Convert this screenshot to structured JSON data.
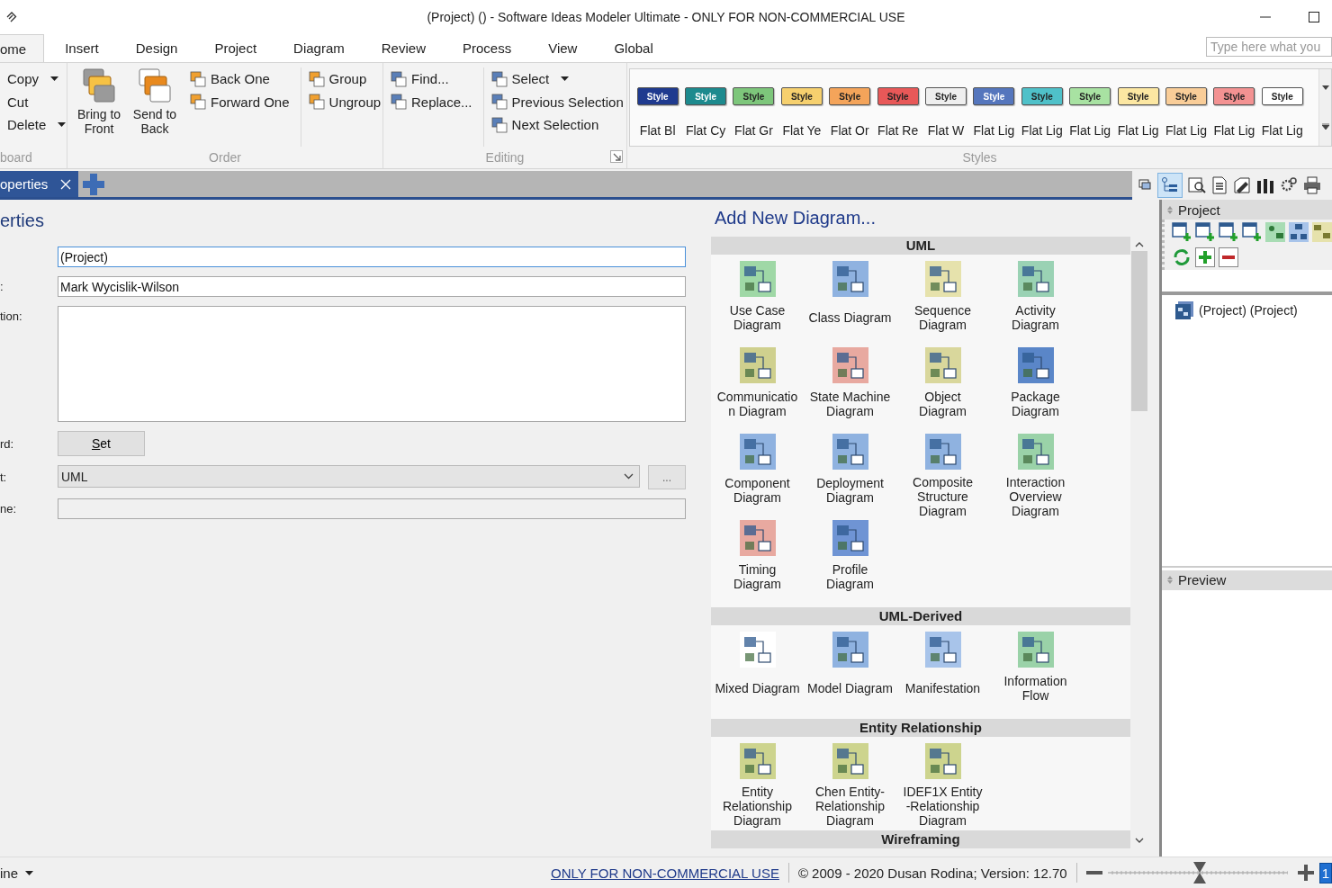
{
  "window": {
    "title": "(Project) ()  - Software Ideas Modeler Ultimate - ONLY FOR NON-COMMERCIAL USE"
  },
  "tabs": [
    {
      "label": "ome",
      "selected": true
    },
    {
      "label": "Insert",
      "selected": false
    },
    {
      "label": "Design",
      "selected": false
    },
    {
      "label": "Project",
      "selected": false
    },
    {
      "label": "Diagram",
      "selected": false
    },
    {
      "label": "Review",
      "selected": false
    },
    {
      "label": "Process",
      "selected": false
    },
    {
      "label": "View",
      "selected": false
    },
    {
      "label": "Global",
      "selected": false
    }
  ],
  "search": {
    "placeholder": "Type here what you"
  },
  "ribbon": [
    {
      "label": "board",
      "launcher": false,
      "columns": [
        [
          {
            "label": "Copy",
            "kind": "small",
            "dropdown": true
          },
          {
            "label": "Cut",
            "kind": "small",
            "dropdown": false
          },
          {
            "label": "Delete",
            "kind": "small",
            "dropdown": true
          }
        ]
      ]
    },
    {
      "label": "Order",
      "launcher": false,
      "columns": [
        [
          {
            "label": "Bring to Front",
            "kind": "large",
            "dropdown": false
          }
        ],
        [
          {
            "label": "Send to Back",
            "kind": "large",
            "dropdown": false
          }
        ],
        [
          {
            "label": "Back One",
            "kind": "small",
            "dropdown": false
          },
          {
            "label": "Forward One",
            "kind": "small",
            "dropdown": false
          }
        ],
        [
          {
            "label": "Group",
            "kind": "small",
            "dropdown": false
          },
          {
            "label": "Ungroup",
            "kind": "small",
            "dropdown": false
          }
        ]
      ]
    },
    {
      "label": "Editing",
      "launcher": true,
      "columns": [
        [
          {
            "label": "Find...",
            "kind": "small",
            "dropdown": false
          },
          {
            "label": "Replace...",
            "kind": "small",
            "dropdown": false
          }
        ],
        [
          {
            "label": "Select",
            "kind": "small",
            "dropdown": true
          },
          {
            "label": "Previous Selection",
            "kind": "small",
            "dropdown": false
          },
          {
            "label": "Next Selection",
            "kind": "small",
            "dropdown": false
          }
        ]
      ]
    }
  ],
  "styles": {
    "label": "Styles",
    "items": [
      {
        "chip": "Style",
        "name": "Flat Bl",
        "color": "#1f3a8f"
      },
      {
        "chip": "Style",
        "name": "Flat Cy",
        "color": "#1d8a8e"
      },
      {
        "chip": "Style",
        "name": "Flat Gr",
        "color": "#7dc67b"
      },
      {
        "chip": "Style",
        "name": "Flat Ye",
        "color": "#f6d06e"
      },
      {
        "chip": "Style",
        "name": "Flat Or",
        "color": "#f4a45a"
      },
      {
        "chip": "Style",
        "name": "Flat Re",
        "color": "#e85858"
      },
      {
        "chip": "Style",
        "name": "Flat W",
        "color": "#eeeeee"
      },
      {
        "chip": "Style",
        "name": "Flat Lig",
        "color": "#5576bd"
      },
      {
        "chip": "Style",
        "name": "Flat Lig",
        "color": "#4fc1c9"
      },
      {
        "chip": "Style",
        "name": "Flat Lig",
        "color": "#a8e2a2"
      },
      {
        "chip": "Style",
        "name": "Flat Lig",
        "color": "#fce7a2"
      },
      {
        "chip": "Style",
        "name": "Flat Lig",
        "color": "#f9cd98"
      },
      {
        "chip": "Style",
        "name": "Flat Lig",
        "color": "#f39292"
      },
      {
        "chip": "Style",
        "name": "Flat Lig",
        "color": "#ffffff"
      }
    ]
  },
  "document_tabs": [
    {
      "label": "operties",
      "selected": true
    }
  ],
  "properties": {
    "heading": "erties",
    "fields": [
      {
        "kind": "text",
        "value": "(Project)",
        "focused": true,
        "disabled": false
      },
      {
        "kind": "text",
        "label": ":",
        "value": "Mark Wycislik-Wilson",
        "focused": false,
        "disabled": false
      },
      {
        "kind": "textarea",
        "label": "tion:",
        "focused": false,
        "disabled": false
      },
      {
        "kind": "button",
        "label": "rd:",
        "button": "Set"
      },
      {
        "kind": "select",
        "label": "t:",
        "value": "UML",
        "button": "..."
      },
      {
        "kind": "text",
        "label": "ne:",
        "focused": false,
        "disabled": true
      }
    ]
  },
  "add_diagram": {
    "title": "Add New Diagram...",
    "sections": [
      {
        "name": "UML",
        "items": [
          {
            "label": "Use Case Diagram",
            "color": "#9fd8a6"
          },
          {
            "label": "Class Diagram",
            "color": "#8fb2e0"
          },
          {
            "label": "Sequence Diagram",
            "color": "#e6e2ac"
          },
          {
            "label": "Activity Diagram",
            "color": "#9ad2b4"
          },
          {
            "label": "Communication Diagram",
            "color": "#cfd08e"
          },
          {
            "label": "State Machine Diagram",
            "color": "#e8a9a0"
          },
          {
            "label": "Object Diagram",
            "color": "#d9d79c"
          },
          {
            "label": "Package Diagram",
            "color": "#5a86c8"
          },
          {
            "label": "Component Diagram",
            "color": "#8fb2e0"
          },
          {
            "label": "Deployment Diagram",
            "color": "#8fb2e0"
          },
          {
            "label": "Composite Structure Diagram",
            "color": "#8fb2e0"
          },
          {
            "label": "Interaction Overview Diagram",
            "color": "#9ad2a8"
          },
          {
            "label": "Timing Diagram",
            "color": "#e8a9a0"
          },
          {
            "label": "Profile Diagram",
            "color": "#6f94d4"
          }
        ]
      },
      {
        "name": "UML-Derived",
        "items": [
          {
            "label": "Mixed Diagram",
            "color": "#ffffff"
          },
          {
            "label": "Model Diagram",
            "color": "#8fb2e0"
          },
          {
            "label": "Manifestation",
            "color": "#a8c4ea"
          },
          {
            "label": "Information Flow",
            "color": "#9ad2a8"
          }
        ]
      },
      {
        "name": "Entity Relationship",
        "items": [
          {
            "label": "Entity Relationship Diagram",
            "color": "#cdd48e"
          },
          {
            "label": "Chen Entity-Relationship Diagram",
            "color": "#cdd48e"
          },
          {
            "label": "IDEF1X Entity -Relationship Diagram",
            "color": "#cdd48e"
          }
        ]
      },
      {
        "name": "Wireframing"
      }
    ]
  },
  "project_panel": {
    "title": "Project",
    "tree": [
      {
        "label": "(Project) (Project)"
      }
    ]
  },
  "preview_panel": {
    "title": "Preview"
  },
  "status_bar": {
    "mode": "ine",
    "link": "ONLY FOR NON-COMMERCIAL USE",
    "copyright": "© 2009 - 2020 Dusan Rodina; Version: 12.70",
    "zoom": {
      "level": 0.5,
      "value": "1"
    }
  }
}
